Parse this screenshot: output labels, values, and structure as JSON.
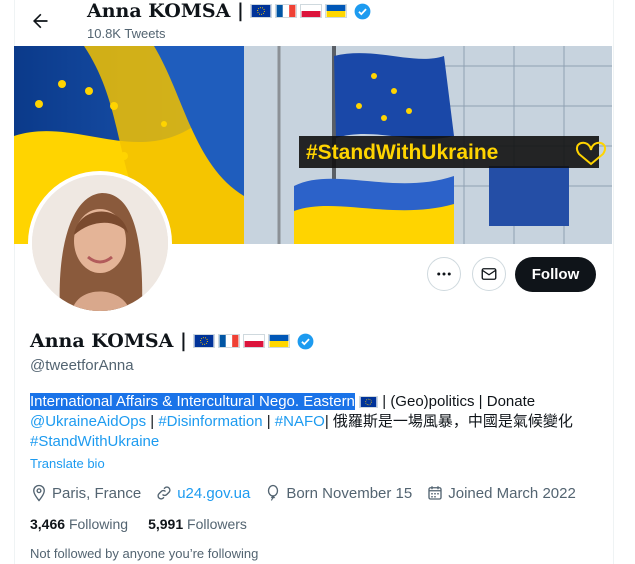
{
  "header": {
    "name": "Anna KOMSA |",
    "tweets": "10.8K Tweets"
  },
  "banner": {
    "hashtag": "#StandWithUkraine"
  },
  "actions": {
    "follow_label": "Follow"
  },
  "profile": {
    "name": "Anna KOMSA |",
    "handle": "@tweetforAnna",
    "bio_line1_highlight": "International Affairs & Intercultural Nego. Eastern",
    "bio_line1_rest": "| (Geo)politics | Donate",
    "bio_link1": "@UkraineAidOps",
    "bio_sep1": " | ",
    "bio_link2": "#Disinformation",
    "bio_sep2": " | ",
    "bio_link3": "#NAFO",
    "bio_line2_rest": "| 俄羅斯是一場風暴，中國是氣候變化",
    "bio_link4": "#StandWithUkraine",
    "translate": "Translate bio",
    "location": "Paris, France",
    "website": "u24.gov.ua",
    "born": "Born November 15",
    "joined": "Joined March 2022",
    "following_count": "3,466",
    "following_label": "Following",
    "followers_count": "5,991",
    "followers_label": "Followers",
    "not_followed": "Not followed by anyone you’re following"
  },
  "colors": {
    "link": "#1d9bf0",
    "verified": "#1d9bf0",
    "eu_blue": "#003399",
    "ua_blue": "#0057b7",
    "ua_yellow": "#ffd700"
  },
  "icons": [
    "back-arrow-icon",
    "eu-flag-icon",
    "france-flag-icon",
    "poland-flag-icon",
    "ukraine-flag-icon",
    "verified-icon",
    "more-icon",
    "message-icon",
    "location-icon",
    "link-icon",
    "balloon-icon",
    "calendar-icon"
  ]
}
